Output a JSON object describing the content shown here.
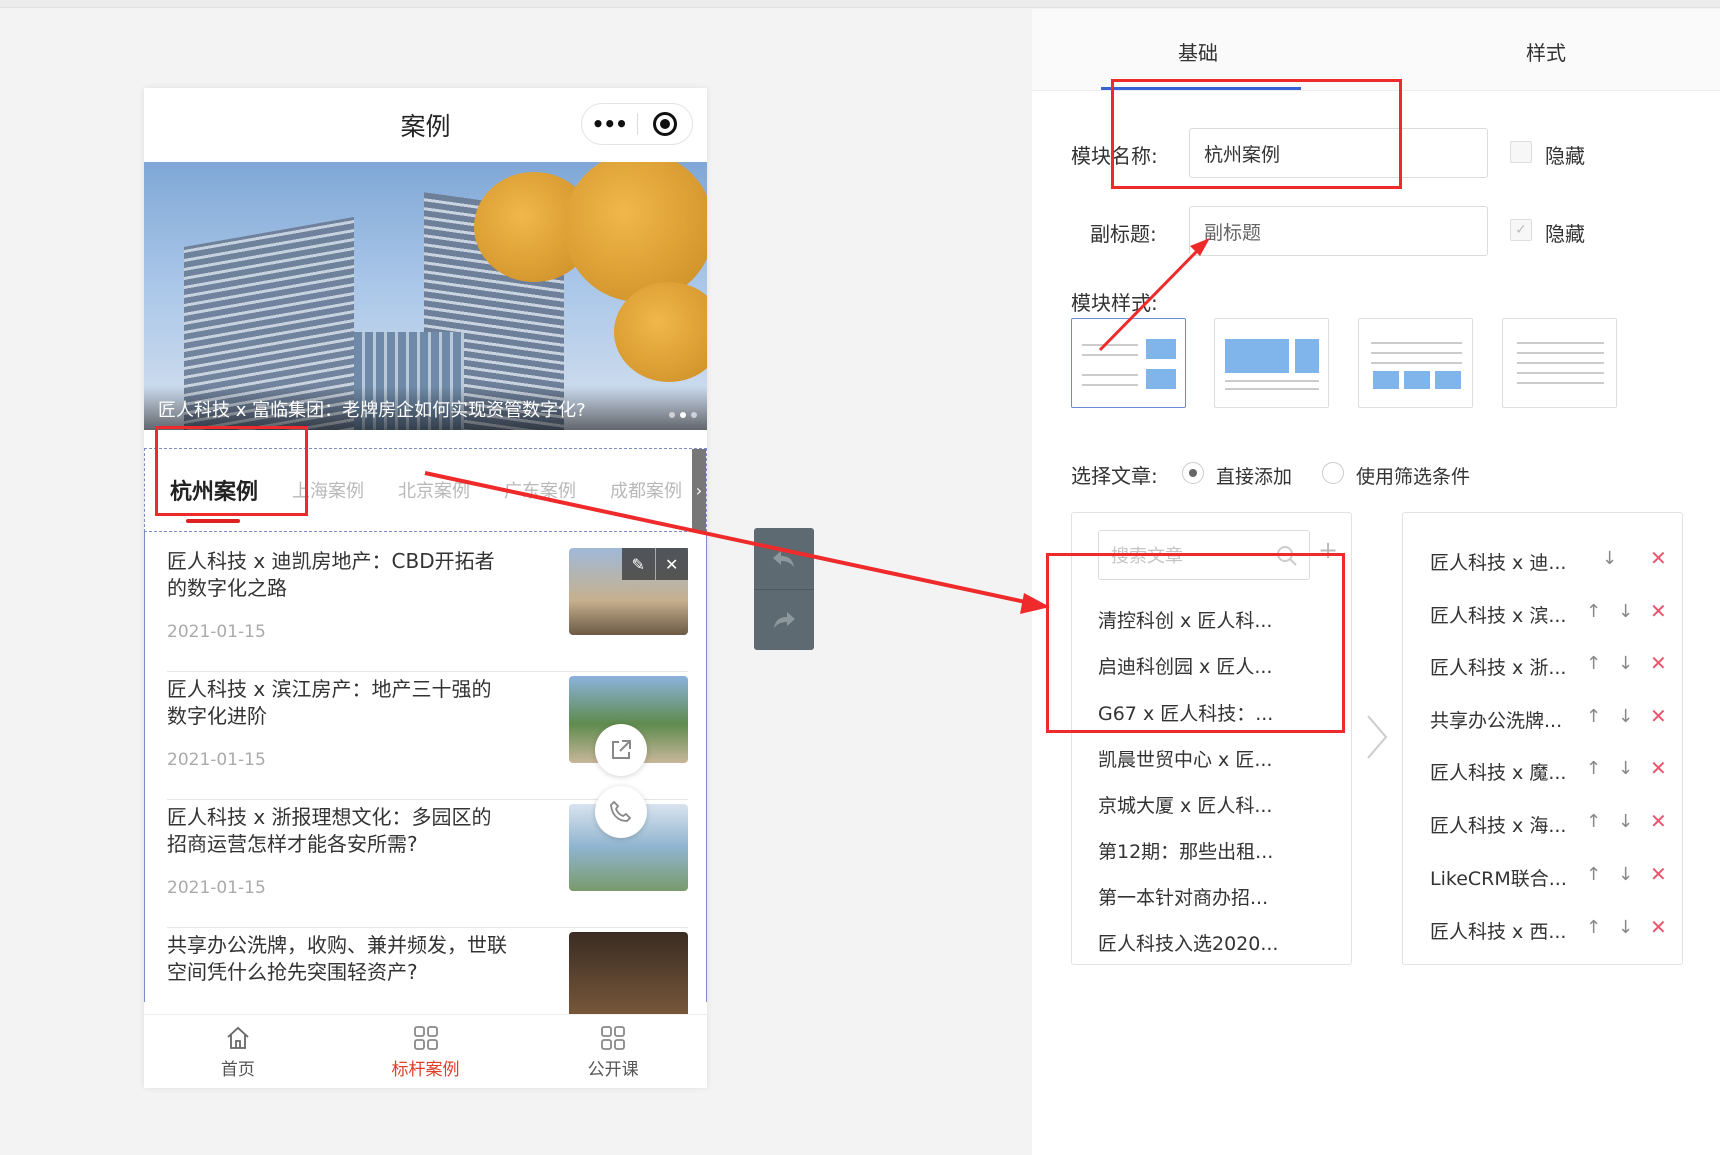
{
  "phone": {
    "title": "案例",
    "capsule_more": "•••",
    "banner_caption": "匠人科技 x 富临集团：老牌房企如何实现资管数字化?",
    "tabs": [
      "杭州案例",
      "上海案例",
      "北京案例",
      "广东案例",
      "成都案例"
    ],
    "articles": [
      {
        "title": "匠人科技 x 迪凯房地产：CBD开拓者的数字化之路",
        "date": "2021-01-15"
      },
      {
        "title": "匠人科技 x 滨江房产：地产三十强的数字化进阶",
        "date": "2021-01-15"
      },
      {
        "title": "匠人科技 x 浙报理想文化：多园区的招商运营怎样才能各安所需?",
        "date": "2021-01-15"
      },
      {
        "title": "共享办公洗牌，收购、兼并频发，世联空间凭什么抢先突围轻资产?",
        "date": ""
      }
    ],
    "bottom_nav": [
      {
        "label": "首页",
        "icon": "home-icon"
      },
      {
        "label": "标杆案例",
        "icon": "grid-icon"
      },
      {
        "label": "公开课",
        "icon": "grid-icon"
      }
    ]
  },
  "panel": {
    "tabs": [
      "基础",
      "样式"
    ],
    "module_name_label": "模块名称:",
    "module_name_value": "杭州案例",
    "subtitle_label": "副标题:",
    "subtitle_placeholder": "副标题",
    "hide_label": "隐藏",
    "module_style_label": "模块样式:",
    "select_article_label": "选择文章:",
    "radio_direct": "直接添加",
    "radio_filter": "使用筛选条件",
    "search_placeholder": "搜索文章",
    "available_articles": [
      "清控科创 x 匠人科...",
      "启迪科创园 x 匠人...",
      "G67 x 匠人科技：...",
      "凯晨世贸中心 x 匠...",
      "京城大厦 x 匠人科...",
      "第12期：那些出租...",
      "第一本针对商办招...",
      "匠人科技入选2020..."
    ],
    "selected_articles": [
      "匠人科技 x 迪...",
      "匠人科技 x 滨...",
      "匠人科技 x 浙...",
      "共享办公洗牌...",
      "匠人科技 x 魔...",
      "匠人科技 x 海...",
      "LikeCRM联合...",
      "匠人科技 x 西..."
    ]
  },
  "colors": {
    "accent_red": "#e0402a",
    "tab_blue": "#3a62d7",
    "delete_pink": "#e8556d",
    "annotation_red": "#ef2a2a"
  }
}
